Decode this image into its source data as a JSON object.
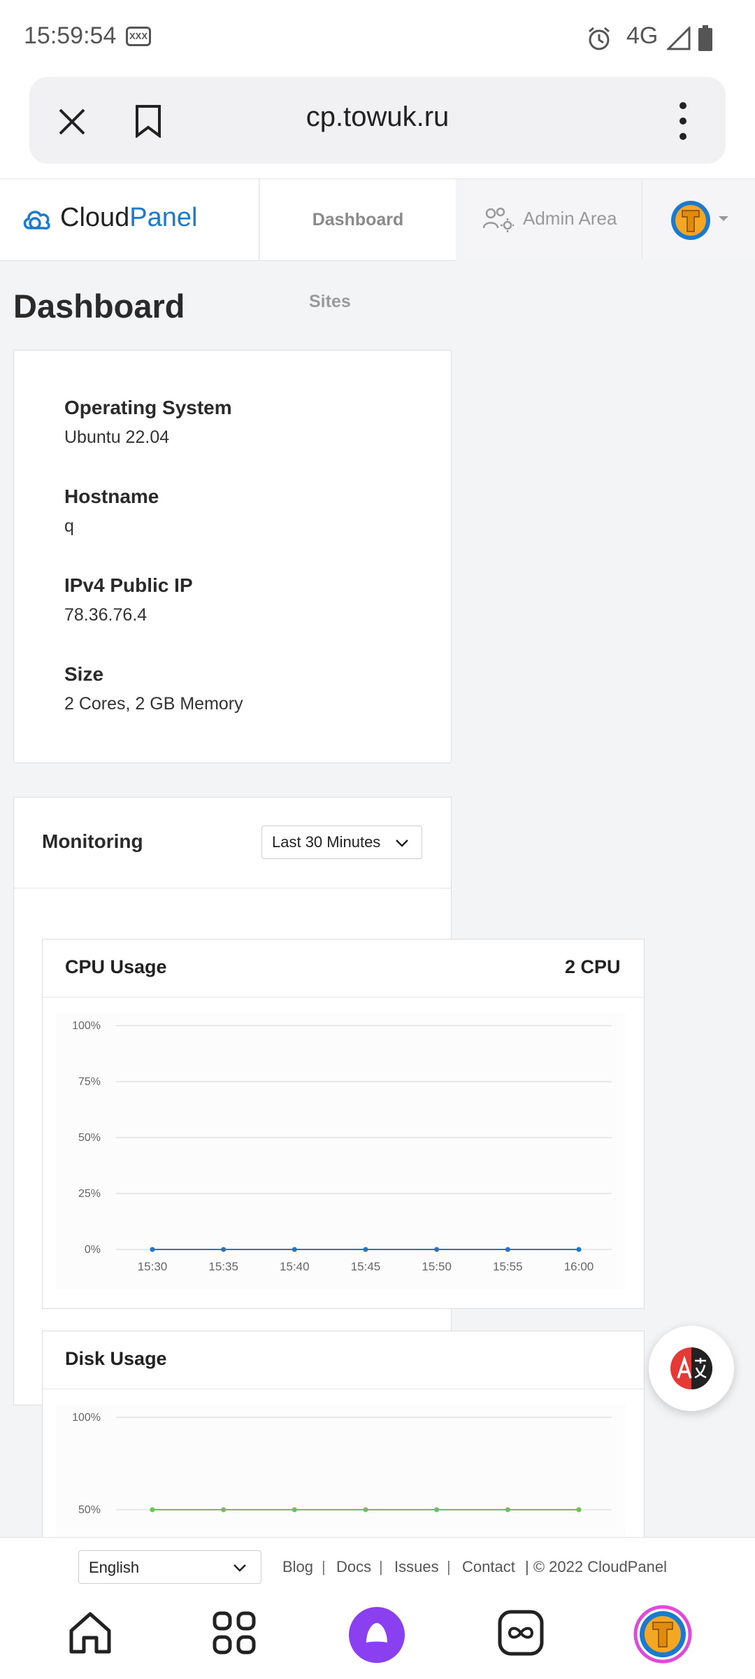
{
  "status_bar": {
    "time": "15:59:54",
    "badge": "XXX",
    "network": "4G",
    "icons": [
      "alarm-icon",
      "signal-icon",
      "battery-icon"
    ]
  },
  "browser": {
    "url": "cp.towuk.ru",
    "icons": [
      "close-icon",
      "bookmark-icon",
      "more-vert-icon"
    ]
  },
  "header": {
    "logo_part1": "Cloud",
    "logo_part2": "Panel",
    "nav_dashboard": "Dashboard",
    "nav_admin": "Admin Area",
    "nav_sites": "Sites",
    "accent_color": "#1a7ad0"
  },
  "page": {
    "title": "Dashboard"
  },
  "server_info": [
    {
      "label": "Operating System",
      "value": "Ubuntu 22.04"
    },
    {
      "label": "Hostname",
      "value": "q"
    },
    {
      "label": "IPv4 Public IP",
      "value": "78.36.76.4"
    },
    {
      "label": "Size",
      "value": "2 Cores, 2 GB Memory"
    }
  ],
  "monitoring": {
    "title": "Monitoring",
    "range": "Last 30 Minutes",
    "cpu": {
      "title": "CPU Usage",
      "badge": "2 CPU"
    },
    "disk": {
      "title": "Disk Usage"
    }
  },
  "chart_data": [
    {
      "type": "line",
      "title": "CPU Usage",
      "categories": [
        "15:30",
        "15:35",
        "15:40",
        "15:45",
        "15:50",
        "15:55",
        "16:00"
      ],
      "y_ticks": [
        "100%",
        "75%",
        "50%",
        "25%",
        "0%"
      ],
      "ylim": [
        0,
        100
      ],
      "series": [
        {
          "values": [
            0,
            0,
            0,
            0,
            0,
            0,
            0
          ],
          "color": "#1f77c8"
        }
      ],
      "grid": true
    },
    {
      "type": "line",
      "title": "Disk Usage",
      "y_ticks": [
        "100%",
        "50%"
      ],
      "ylim": [
        0,
        100
      ],
      "series": [
        {
          "values": [
            50,
            50,
            50,
            50,
            50,
            50,
            50
          ],
          "color": "#6cc24a"
        }
      ],
      "grid": true
    }
  ],
  "footer": {
    "language": "English",
    "links": [
      "Blog",
      "Docs",
      "Issues",
      "Contact"
    ],
    "copyright": "| © 2022  CloudPanel"
  },
  "bottom_nav": [
    "home-icon",
    "apps-icon",
    "assistant-icon",
    "infinity-icon",
    "profile-icon"
  ]
}
